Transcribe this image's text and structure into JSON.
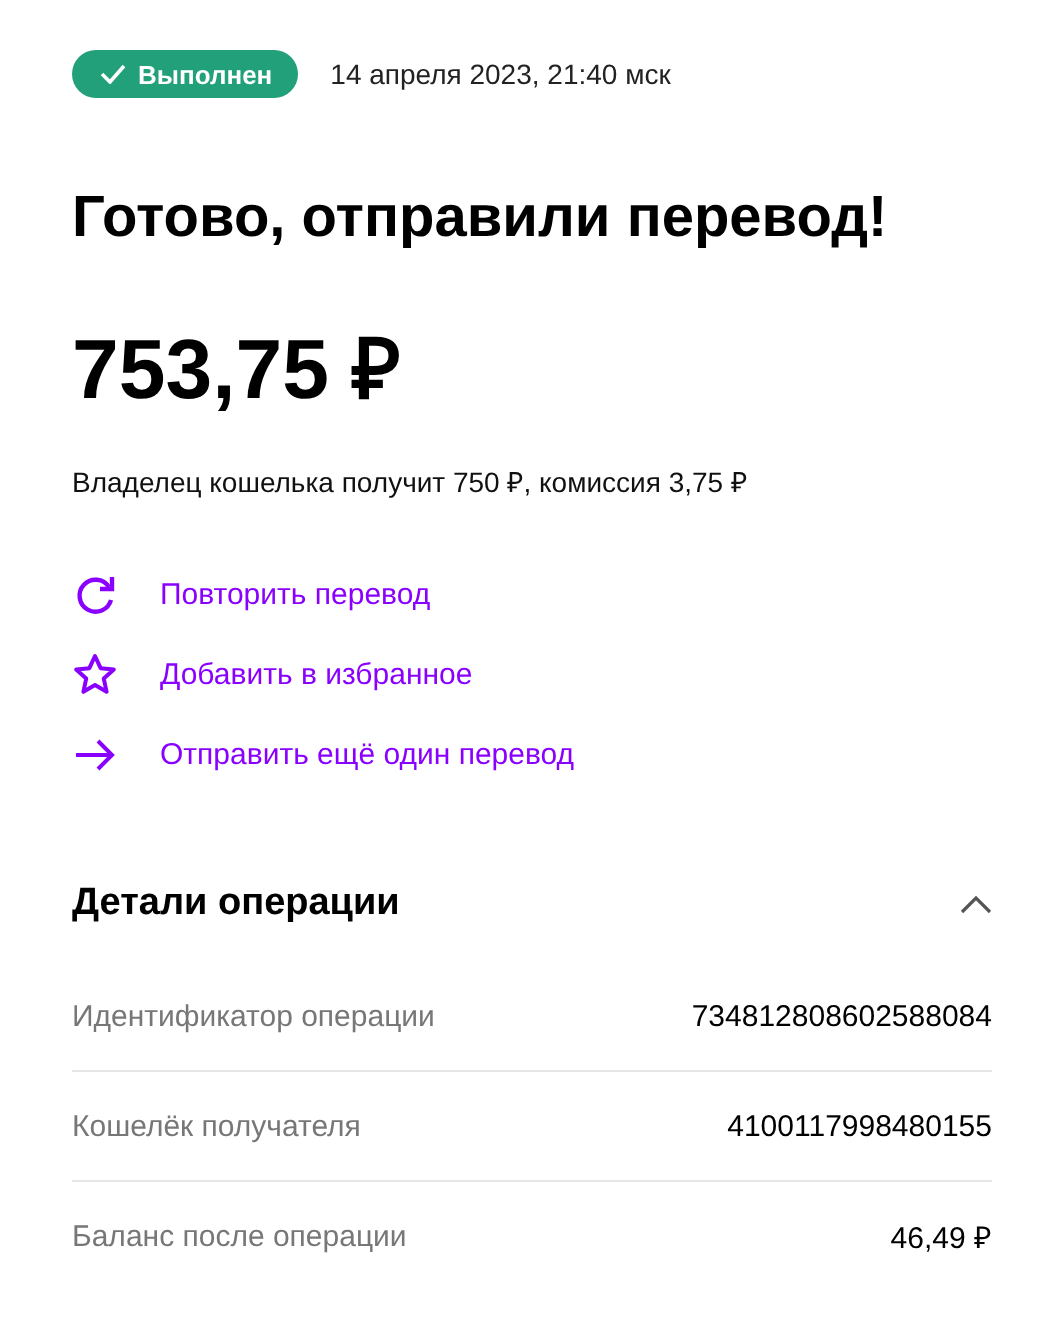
{
  "status": {
    "label": "Выполнен",
    "done": true,
    "datetime": "14 апреля 2023, 21:40 мск"
  },
  "title": "Готово, отправили перевод!",
  "amount": "753,75 ₽",
  "note": "Владелец кошелька получит 750 ₽, комиссия 3,75 ₽",
  "actions": [
    {
      "kind": "repeat",
      "label": "Повторить перевод"
    },
    {
      "kind": "favorite",
      "label": "Добавить в избранное"
    },
    {
      "kind": "send",
      "label": "Отправить ещё один перевод"
    }
  ],
  "details": {
    "title": "Детали операции",
    "expanded": true,
    "rows": [
      {
        "label": "Идентификатор операции",
        "value": "734812808602588084"
      },
      {
        "label": "Кошелёк получателя",
        "value": "4100117998480155"
      },
      {
        "label": "Баланс после операции",
        "value": "46,49 ₽"
      }
    ]
  }
}
